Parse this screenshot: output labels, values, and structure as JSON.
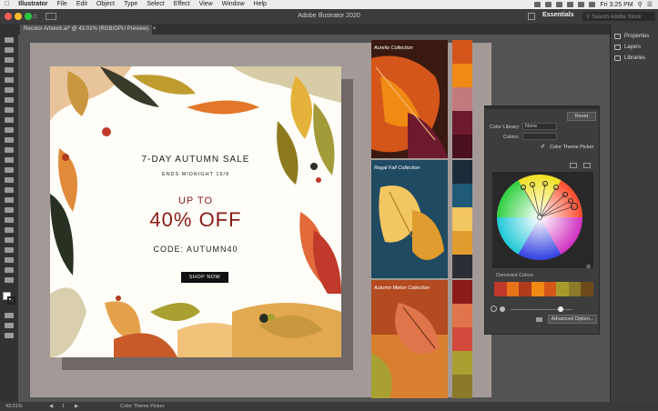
{
  "menubar": {
    "apple_icon": "apple-icon",
    "app_name": "Illustrator",
    "items": [
      "File",
      "Edit",
      "Object",
      "Type",
      "Select",
      "Effect",
      "View",
      "Window",
      "Help"
    ],
    "clock": "Fri 3:25 PM"
  },
  "appbar": {
    "title": "Adobe Illustrator 2020",
    "workspace": "Essentials",
    "search_placeholder": "Search Adobe Stock"
  },
  "document": {
    "tab_label": "Recolor Artwork.ai* @ 43.01% (RGB/GPU Preview)",
    "close_icon": "×"
  },
  "artwork": {
    "headline": "7-DAY AUTUMN SALE",
    "subline": "ENDS MIDNIGHT 19/9",
    "upto": "UP TO",
    "offer": "40% OFF",
    "code": "CODE: AUTUMN40",
    "cta": "SHOP NOW"
  },
  "collections": [
    {
      "title": "Aurelio Collection",
      "swatches": [
        "#d4561a",
        "#f08a14",
        "#c27a7d",
        "#6e1a2e",
        "#4a1020"
      ]
    },
    {
      "title": "Regal Fall Collection",
      "swatches": [
        "#1c2b3a",
        "#1f5a78",
        "#f2c660",
        "#e09c2e",
        "#2b2e35"
      ]
    },
    {
      "title": "Autumn Melon Collection",
      "swatches": [
        "#8a1b18",
        "#e0744a",
        "#d24a3c",
        "#a8a030",
        "#8a7a2a"
      ]
    }
  ],
  "recolor_panel": {
    "reset_label": "Reset",
    "library_label": "Color Library:",
    "library_value": "None",
    "colors_label": "Colors:",
    "picker_label": "Color Theme Picker",
    "dominant_label": "Dominant Colors",
    "dominant": [
      "#c0392b",
      "#e8731a",
      "#b03a1c",
      "#f08a14",
      "#d4561a",
      "#a89a2a",
      "#8a7a2a",
      "#6e4a1a"
    ],
    "advanced_label": "Advanced Option..."
  },
  "right_panel": {
    "items": [
      "Properties",
      "Layers",
      "Libraries"
    ]
  },
  "status": {
    "zoom": "43.01%",
    "page": "1",
    "tool_name": "Color Theme Picker"
  }
}
